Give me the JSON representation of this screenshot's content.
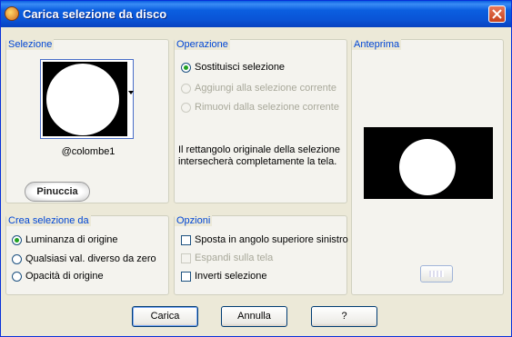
{
  "window": {
    "title": "Carica selezione da disco"
  },
  "selezione": {
    "title": "Selezione",
    "name": "@colombe1",
    "logo_text": "Pinuccia"
  },
  "operazione": {
    "title": "Operazione",
    "options": [
      {
        "label": "Sostituisci selezione",
        "selected": true,
        "enabled": true
      },
      {
        "label": "Aggiungi alla selezione corrente",
        "selected": false,
        "enabled": false
      },
      {
        "label": "Rimuovi dalla selezione corrente",
        "selected": false,
        "enabled": false
      }
    ],
    "info_line1": "Il rettangolo originale della selezione",
    "info_line2": "intersecherà completamente la tela."
  },
  "anteprima": {
    "title": "Anteprima"
  },
  "crea": {
    "title": "Crea selezione da",
    "options": [
      {
        "label": "Luminanza di origine",
        "selected": true
      },
      {
        "label": "Qualsiasi val. diverso da zero",
        "selected": false
      },
      {
        "label": "Opacità di origine",
        "selected": false
      }
    ]
  },
  "opzioni": {
    "title": "Opzioni",
    "options": [
      {
        "label": "Sposta in angolo superiore sinistro",
        "checked": false,
        "enabled": true
      },
      {
        "label": "Espandi sulla tela",
        "checked": false,
        "enabled": false
      },
      {
        "label": "Inverti selezione",
        "checked": false,
        "enabled": true
      }
    ]
  },
  "buttons": {
    "load": "Carica",
    "cancel": "Annulla",
    "help": "?"
  },
  "colors": {
    "title_bar": "#0a54d6",
    "group_title": "#0046d5",
    "dialog_bg": "#ece9d8"
  }
}
